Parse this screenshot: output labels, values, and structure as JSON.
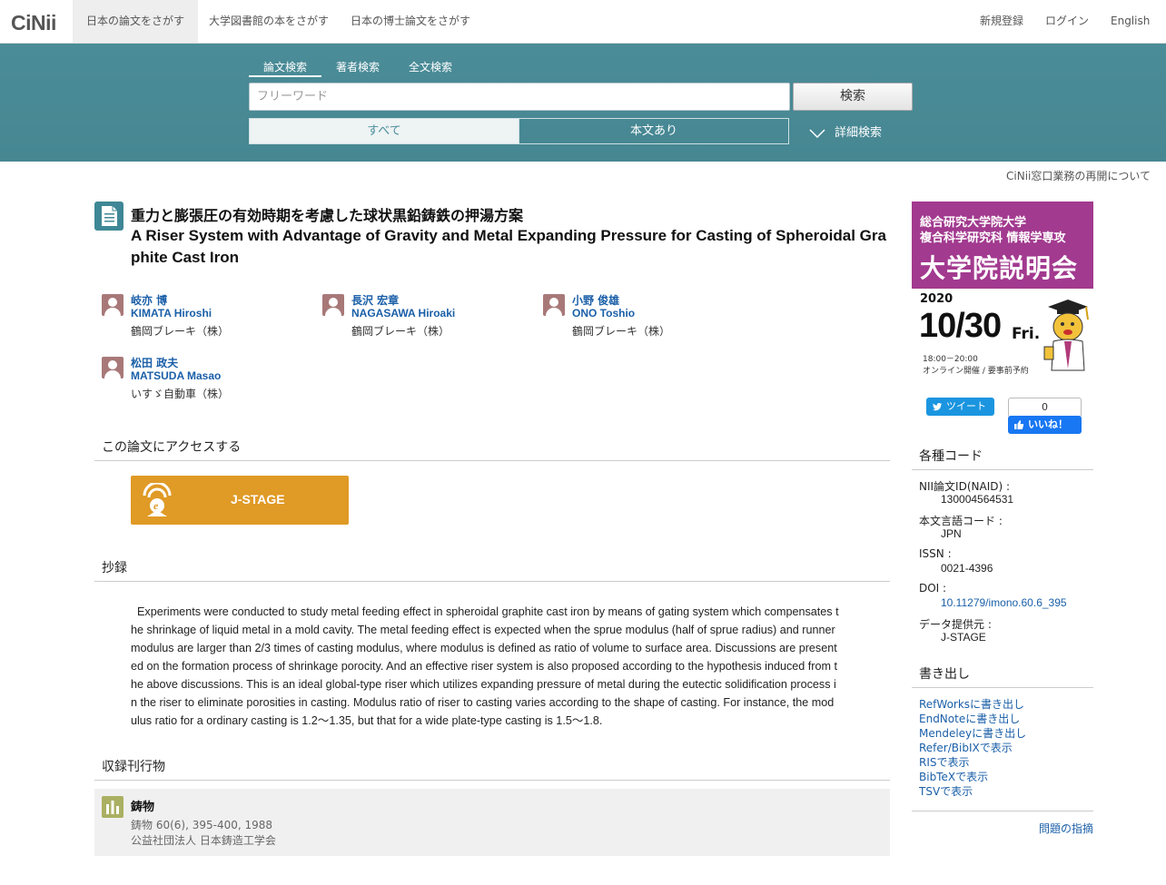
{
  "nav": {
    "logo": "CiNii",
    "tabs": [
      "日本の論文をさがす",
      "大学図書館の本をさがす",
      "日本の博士論文をさがす"
    ],
    "right": [
      "新規登録",
      "ログイン",
      "English"
    ]
  },
  "search": {
    "tabs": [
      "論文検索",
      "著者検索",
      "全文検索"
    ],
    "placeholder": "フリーワード",
    "button": "検索",
    "filters": [
      "すべて",
      "本文あり"
    ],
    "advanced": "詳細検索"
  },
  "notice": "CiNii窓口業務の再開について",
  "article": {
    "title_ja": "重力と膨張圧の有効時期を考慮した球状黒鉛鋳鉄の押湯方案",
    "title_en": "A Riser System with Advantage of Gravity and Metal Expanding Pressure for Casting of Spheroidal Graphite Cast Iron",
    "authors": [
      {
        "name_ja": "岐亦 博",
        "name_en": "KIMATA Hiroshi",
        "affiliation": "鶴岡ブレーキ（株）"
      },
      {
        "name_ja": "長沢 宏章",
        "name_en": "NAGASAWA Hiroaki",
        "affiliation": "鶴岡ブレーキ（株）"
      },
      {
        "name_ja": "小野 俊雄",
        "name_en": "ONO Toshio",
        "affiliation": "鶴岡ブレーキ（株）"
      },
      {
        "name_ja": "松田 政夫",
        "name_en": "MATSUDA Masao",
        "affiliation": "いすゞ自動車（株）"
      }
    ],
    "access_heading": "この論文にアクセスする",
    "access_button": "J-STAGE",
    "abstract_heading": "抄録",
    "abstract": "  Experiments were conducted to study metal feeding effect in spheroidal graphite cast iron by means of gating system which compensates the shrinkage of liquid metal in a mold cavity. The metal feeding effect is expected when the sprue modulus (half of sprue radius) and runner modulus are larger than 2/3 times of casting modulus, where modulus is defined as ratio of volume to surface area. Discussions are presented on the formation process of shrinkage porocity. And an effective riser system is also proposed according to the hypothesis induced from the above discussions. This is an ideal global-type riser which utilizes expanding pressure of metal during the eutectic solidification process in the riser to eliminate porosities in casting. Modulus ratio of riser to casting varies according to the shape of casting. For instance, the modulus ratio for a ordinary casting is 1.2～1.35, but that for a wide plate-type casting is 1.5～1.8.",
    "journal_heading": "収録刊行物",
    "journal": {
      "name": "鋳物",
      "volume": "鋳物 60(6), 395-400, 1988",
      "publisher": "公益社団法人 日本鋳造工学会"
    }
  },
  "banner": {
    "line1": "総合研究大学院大学",
    "line2": "複合科学研究科 情報学専攻",
    "line3": "大学院説明会",
    "year": "2020",
    "date": "10/30",
    "day": "Fri.",
    "time": "18:00－20:00",
    "mode": "オンライン開催 / 要事前予約"
  },
  "social": {
    "tweet": "ツイート",
    "like_count": "0",
    "like": "いいね！"
  },
  "codes": {
    "heading": "各種コード",
    "items": [
      {
        "label": "NII論文ID(NAID) :",
        "value": "130004564531"
      },
      {
        "label": "本文言語コード :",
        "value": "JPN"
      },
      {
        "label": "ISSN :",
        "value": "0021-4396"
      },
      {
        "label": "DOI :",
        "value": "10.11279/imono.60.6_395"
      },
      {
        "label": "データ提供元 :",
        "value": "J-STAGE"
      }
    ]
  },
  "export": {
    "heading": "書き出し",
    "items": [
      "RefWorksに書き出し",
      "EndNoteに書き出し",
      "Mendeleyに書き出し",
      "Refer/BibIXで表示",
      "RISで表示",
      "BibTeXで表示",
      "TSVで表示"
    ]
  },
  "report": "問題の指摘",
  "colors": {
    "band": "#4b8e9a",
    "link": "#1a5fa8",
    "jstage": "#e09a26",
    "banner": "#a23a8f"
  }
}
